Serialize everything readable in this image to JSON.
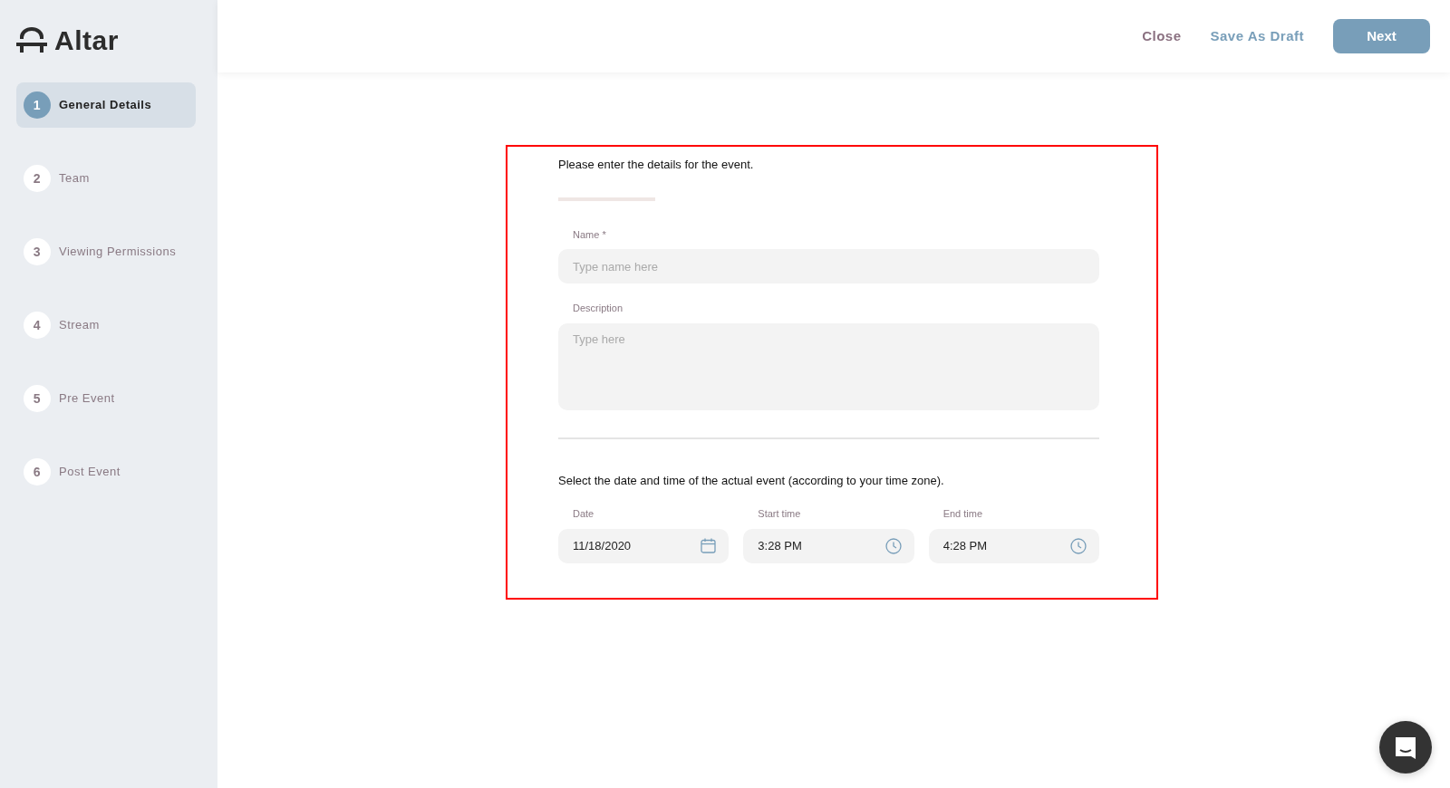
{
  "logo": {
    "text": "Altar"
  },
  "steps": [
    {
      "number": "1",
      "label": "General Details",
      "selected": true
    },
    {
      "number": "2",
      "label": "Team",
      "selected": false
    },
    {
      "number": "3",
      "label": "Viewing Permissions",
      "selected": false
    },
    {
      "number": "4",
      "label": "Stream",
      "selected": false
    },
    {
      "number": "5",
      "label": "Pre Event",
      "selected": false
    },
    {
      "number": "6",
      "label": "Post Event",
      "selected": false
    }
  ],
  "header": {
    "close": "Close",
    "save_draft": "Save As Draft",
    "next": "Next"
  },
  "form": {
    "intro": "Please enter the details for the event.",
    "name": {
      "label": "Name *",
      "placeholder": "Type name here"
    },
    "description": {
      "label": "Description",
      "placeholder": "Type here"
    },
    "datetime_intro": "Select the date and time of the actual event (according to your time zone).",
    "datetime_fields": [
      {
        "kind": "date",
        "label": "Date",
        "value": "11/18/2020"
      },
      {
        "kind": "time",
        "label": "Start time",
        "value": "3:28 PM"
      },
      {
        "kind": "time",
        "label": "End time",
        "value": "4:28 PM"
      }
    ]
  }
}
